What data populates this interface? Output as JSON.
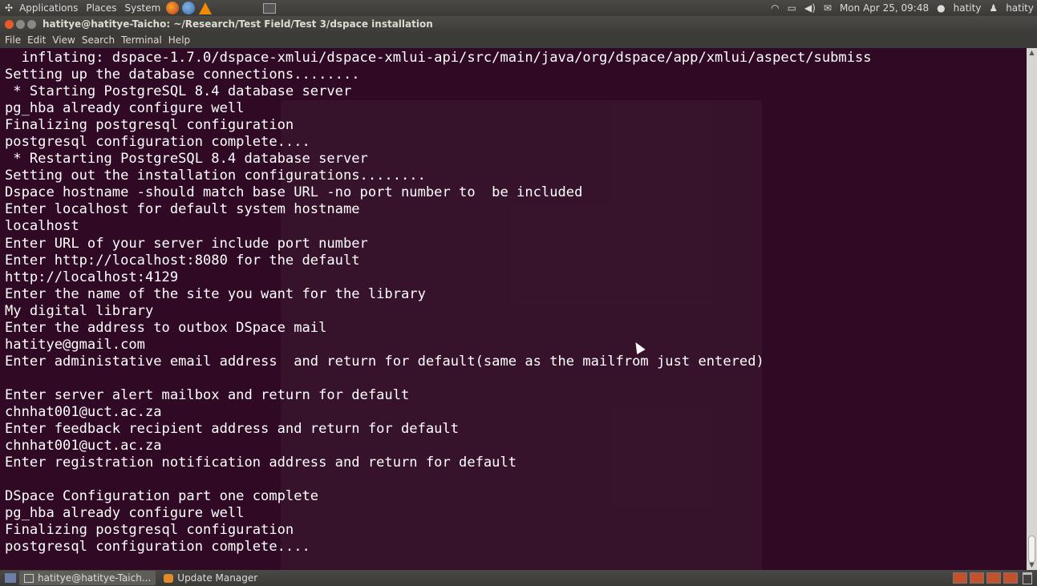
{
  "top_panel": {
    "menus": [
      "Applications",
      "Places",
      "System"
    ],
    "clock": "Mon Apr 25, 09:48",
    "user": "hatity",
    "user2": "hatity"
  },
  "window": {
    "title": "hatitye@hatitye-Taicho: ~/Research/Test Field/Test 3/dspace installation",
    "menu": [
      "File",
      "Edit",
      "View",
      "Search",
      "Terminal",
      "Help"
    ]
  },
  "terminal": {
    "lines": [
      "  inflating: dspace-1.7.0/dspace-xmlui/dspace-xmlui-api/src/main/java/org/dspace/app/xmlui/aspect/submiss",
      "Setting up the database connections........",
      " * Starting PostgreSQL 8.4 database server",
      "pg_hba already configure well",
      "Finalizing postgresql configuration",
      "postgresql configuration complete....",
      " * Restarting PostgreSQL 8.4 database server",
      "Setting out the installation configurations........",
      "Dspace hostname -should match base URL -no port number to  be included",
      "Enter localhost for default system hostname",
      "localhost",
      "Enter URL of your server include port number",
      "Enter http://localhost:8080 for the default",
      "http://localhost:4129",
      "Enter the name of the site you want for the library",
      "My digital library",
      "Enter the address to outbox DSpace mail",
      "hatitye@gmail.com",
      "Enter administative email address  and return for default(same as the mailfrom just entered)",
      "",
      "Enter server alert mailbox and return for default",
      "chnhat001@uct.ac.za",
      "Enter feedback recipient address and return for default",
      "chnhat001@uct.ac.za",
      "Enter registration notification address and return for default",
      "",
      "DSpace Configuration part one complete",
      "pg_hba already configure well",
      "Finalizing postgresql configuration",
      "postgresql configuration complete...."
    ]
  },
  "taskbar": {
    "tasks": [
      {
        "label": "hatitye@hatitye-Taich..."
      },
      {
        "label": "Update Manager"
      }
    ]
  },
  "colors": {
    "terminal_bg": "#300a24",
    "panel_bg": "#3c3b37",
    "text": "#ffffff"
  }
}
